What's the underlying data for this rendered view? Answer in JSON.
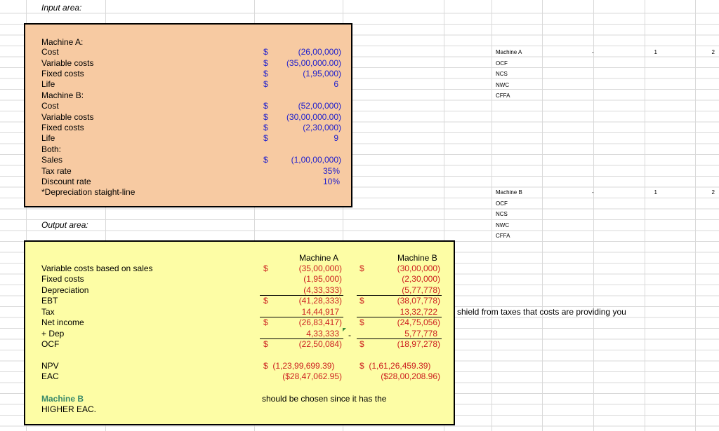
{
  "input_area_title": "Input area:",
  "output_area_title": "Output area:",
  "inputs": {
    "machine_a_header": "Machine A:",
    "machine_b_header": "Machine B:",
    "both_header": "Both:",
    "labels": {
      "cost": "Cost",
      "variable_costs": "Variable costs",
      "fixed_costs": "Fixed costs",
      "life": "Life",
      "sales": "Sales",
      "tax_rate": "Tax rate",
      "discount_rate": "Discount rate",
      "depreciation_note": "*Depreciation staight-line"
    },
    "currency": "$",
    "machine_a": {
      "cost": "(26,00,000)",
      "variable_costs": "(35,00,000.00)",
      "fixed_costs": "(1,95,000)",
      "life": "6"
    },
    "machine_b": {
      "cost": "(52,00,000)",
      "variable_costs": "(30,00,000.00)",
      "fixed_costs": "(2,30,000)",
      "life": "9"
    },
    "both": {
      "sales": "(1,00,00,000)",
      "tax_rate": "35%",
      "discount_rate": "10%"
    }
  },
  "outputs": {
    "col_a": "Machine A",
    "col_b": "Machine B",
    "currency": "$",
    "rows": {
      "variable_costs": {
        "label": "Variable costs based on sales",
        "a": "(35,00,000)",
        "b": "(30,00,000)"
      },
      "fixed_costs": {
        "label": "Fixed costs",
        "a": "(1,95,000)",
        "b": "(2,30,000)"
      },
      "depreciation": {
        "label": "Depreciation",
        "a": "(4,33,333)",
        "b": "(5,77,778)"
      },
      "ebt": {
        "label": "EBT",
        "a": "(41,28,333)",
        "b": "(38,07,778)"
      },
      "tax": {
        "label": "Tax",
        "a": "14,44,917",
        "b": "13,32,722"
      },
      "net_income": {
        "label": "Net income",
        "a": "(26,83,417)",
        "b": "(24,75,056)"
      },
      "dep": {
        "label": "+ Dep",
        "a": "4,33,333",
        "b": "5,77,778"
      },
      "ocf": {
        "label": "OCF",
        "a": "(22,50,084)",
        "b": "(18,97,278)"
      }
    },
    "npv": {
      "label": "NPV",
      "a": "$  (1,23,99,699.39)",
      "b": "$  (1,61,26,459.39)"
    },
    "eac": {
      "label": "EAC",
      "a": "($28,47,062.95)",
      "b": "($28,00,208.96)"
    },
    "dash": "-",
    "conclusion_machine": "Machine B",
    "conclusion_text": "should be chosen since it has the",
    "conclusion_tail": "HIGHER EAC."
  },
  "note_shield": "shield from taxes that costs are providing you",
  "side_tables": {
    "machine_a": {
      "title": "Machine A",
      "rows": [
        "OCF",
        "NCS",
        "NWC",
        "CFFA"
      ],
      "col_dash": "-",
      "col_1": "1",
      "col_2": "2"
    },
    "machine_b": {
      "title": "Machine B",
      "rows": [
        "OCF",
        "NCS",
        "NWC",
        "CFFA"
      ],
      "col_dash": "-",
      "col_1": "1",
      "col_2": "2"
    }
  }
}
